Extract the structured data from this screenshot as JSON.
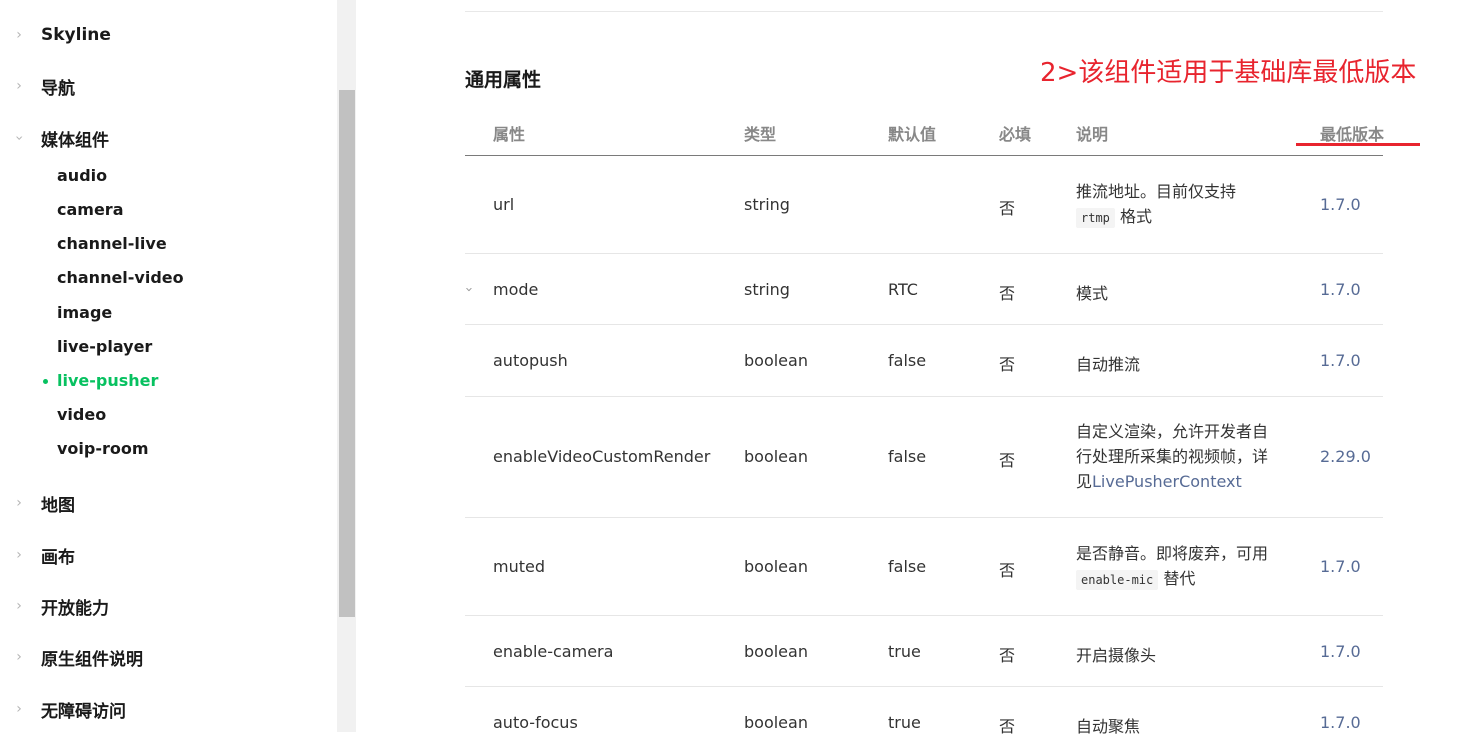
{
  "sidebar": {
    "groups_top": [
      {
        "label": "Skyline"
      },
      {
        "label": "导航"
      },
      {
        "label": "媒体组件"
      }
    ],
    "media_items": [
      "audio",
      "camera",
      "channel-live",
      "channel-video",
      "image",
      "live-player",
      "live-pusher",
      "video",
      "voip-room"
    ],
    "active_item": "live-pusher",
    "groups_bottom": [
      {
        "label": "地图"
      },
      {
        "label": "画布"
      },
      {
        "label": "开放能力"
      },
      {
        "label": "原生组件说明"
      },
      {
        "label": "无障碍访问"
      }
    ]
  },
  "main": {
    "section_title": "通用属性",
    "annotation": "2>该组件适用于基础库最低版本",
    "annotation_color": "#e8242e",
    "columns": [
      "属性",
      "类型",
      "默认值",
      "必填",
      "说明",
      "最低版本"
    ],
    "rows": [
      {
        "name": "url",
        "type": "string",
        "default": "",
        "required": "否",
        "desc_parts": [
          "推流地址。目前仅支持"
        ],
        "desc_code": "rtmp",
        "desc_after": "格式",
        "version": "1.7.0"
      },
      {
        "name": "mode",
        "type": "string",
        "default": "RTC",
        "required": "否",
        "desc": "模式",
        "version": "1.7.0",
        "expandable": true
      },
      {
        "name": "autopush",
        "type": "boolean",
        "default": "false",
        "required": "否",
        "desc": "自动推流",
        "version": "1.7.0"
      },
      {
        "name": "enableVideoCustomRender",
        "type": "boolean",
        "default": "false",
        "required": "否",
        "desc_lines": [
          "自定义渲染，允许开发者自",
          "行处理所采集的视频帧，详"
        ],
        "desc_line3_prefix": "见",
        "desc_link": "LivePusherContext",
        "version": "2.29.0"
      },
      {
        "name": "muted",
        "type": "boolean",
        "default": "false",
        "required": "否",
        "desc_parts": [
          "是否静音。即将废弃，可用"
        ],
        "desc_code": "enable-mic",
        "desc_after": "替代",
        "version": "1.7.0"
      },
      {
        "name": "enable-camera",
        "type": "boolean",
        "default": "true",
        "required": "否",
        "desc": "开启摄像头",
        "version": "1.7.0"
      },
      {
        "name": "auto-focus",
        "type": "boolean",
        "default": "true",
        "required": "否",
        "desc": "自动聚焦",
        "version": "1.7.0"
      }
    ],
    "link_color": "#576b95",
    "accent_green": "#07c160"
  }
}
